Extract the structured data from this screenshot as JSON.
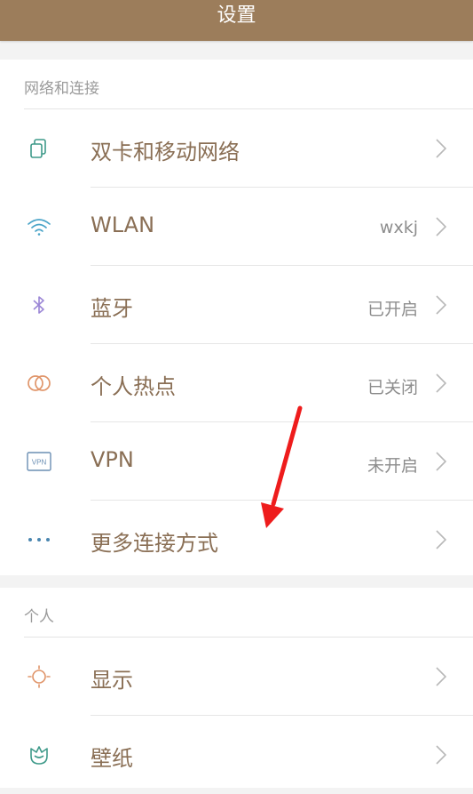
{
  "header": {
    "title": "设置"
  },
  "sections": [
    {
      "title": "网络和连接",
      "items": [
        {
          "label": "双卡和移动网络",
          "value": "",
          "icon": "sim-cards-icon"
        },
        {
          "label": "WLAN",
          "value": "wxkj",
          "icon": "wifi-icon"
        },
        {
          "label": "蓝牙",
          "value": "已开启",
          "icon": "bluetooth-icon"
        },
        {
          "label": "个人热点",
          "value": "已关闭",
          "icon": "hotspot-icon"
        },
        {
          "label": "VPN",
          "value": "未开启",
          "icon": "vpn-icon"
        },
        {
          "label": "更多连接方式",
          "value": "",
          "icon": "more-dots-icon"
        }
      ]
    },
    {
      "title": "个人",
      "items": [
        {
          "label": "显示",
          "value": "",
          "icon": "sun-icon"
        },
        {
          "label": "壁纸",
          "value": "",
          "icon": "wallpaper-icon"
        }
      ]
    }
  ],
  "vpn_icon_text": "VPN",
  "colors": {
    "header_bg": "#9c7d5b",
    "label_text": "#8a6f55",
    "annotation_arrow": "#ee1c1c"
  }
}
